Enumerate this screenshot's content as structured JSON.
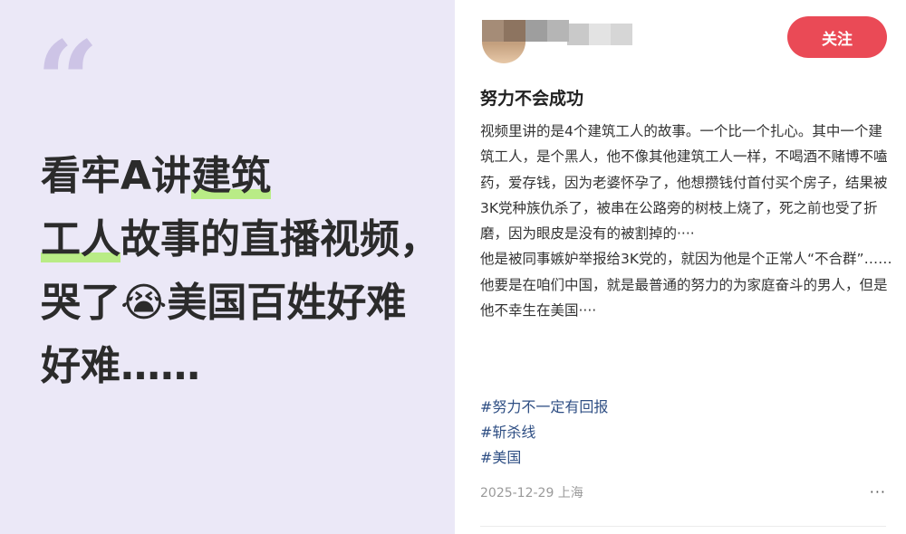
{
  "left_card": {
    "headline_parts": [
      "看牢A讲",
      "建筑",
      "工人",
      "故事的直播视频，哭了😭美国百姓好难好难……"
    ]
  },
  "post": {
    "follow_label": "关注",
    "title": "努力不会成功",
    "body": [
      "视频里讲的是4个建筑工人的故事。一个比一个扎心。其中一个建筑工人，是个黑人，他不像其他建筑工人一样，不喝酒不赌博不嗑药，爱存钱，因为老婆怀孕了，他想攒钱付首付买个房子，结果被3K党种族仇杀了，被串在公路旁的树枝上烧了，死之前也受了折磨，因为眼皮是没有的被割掉的····",
      "他是被同事嫉妒举报给3K党的，就因为他是个正常人“不合群”……",
      "他要是在咱们中国，就是最普通的努力的为家庭奋斗的男人，但是他不幸生在美国····"
    ],
    "hashtags": [
      "#努力不一定有回报",
      "#斩杀线",
      "#美国"
    ],
    "date_location": "2025-12-29 上海",
    "more_glyph": "···"
  },
  "colors": {
    "left_background": "#ebe8f7",
    "highlight": "#b9ec86",
    "follow_button": "#ea4a56",
    "hashtag": "#2f4f84"
  }
}
